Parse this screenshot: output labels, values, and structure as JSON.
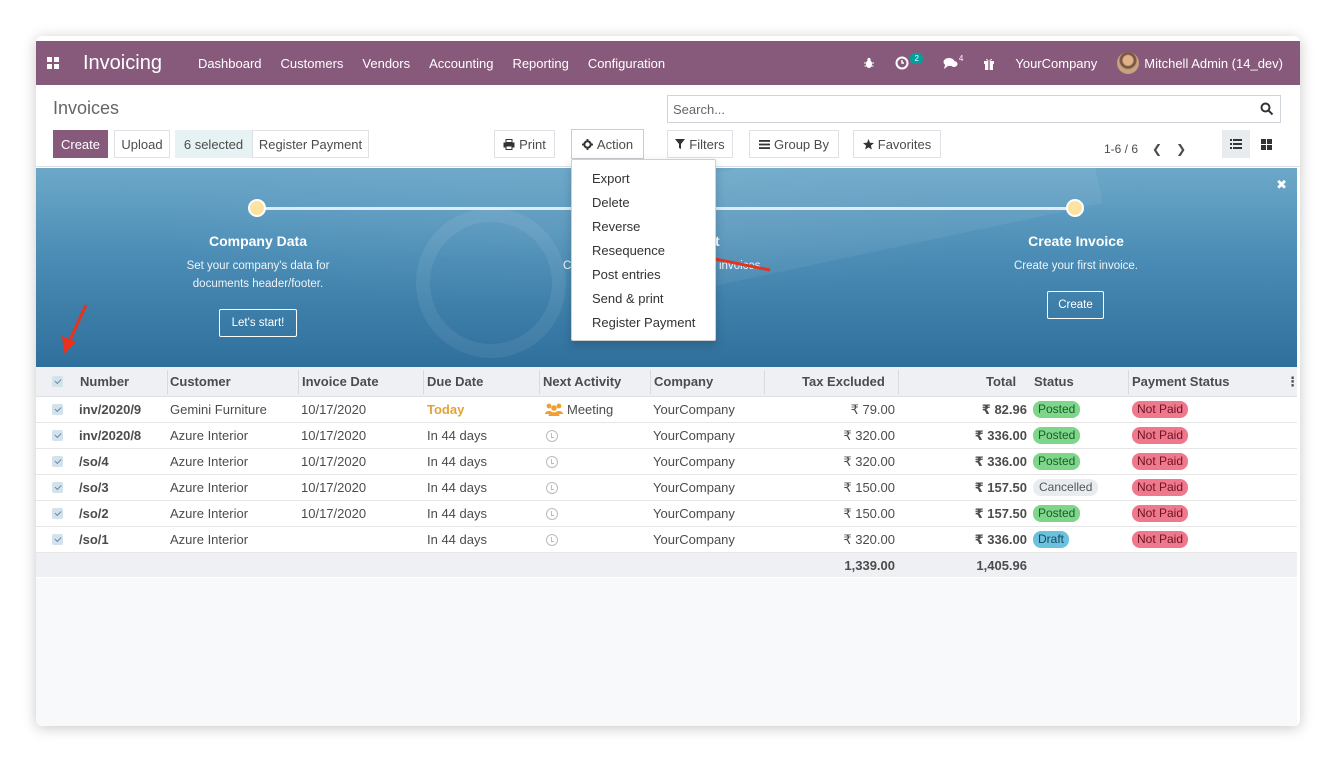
{
  "navbar": {
    "app_name": "Invoicing",
    "menu": [
      "Dashboard",
      "Customers",
      "Vendors",
      "Accounting",
      "Reporting",
      "Configuration"
    ],
    "activity_count": "2",
    "message_count": "4",
    "company": "YourCompany",
    "user": "Mitchell Admin (14_dev)",
    "brand_color": "#875a7b"
  },
  "control_panel": {
    "breadcrumb": "Invoices",
    "search_placeholder": "Search...",
    "create_label": "Create",
    "upload_label": "Upload",
    "selected_label": "6 selected",
    "register_payment_label": "Register Payment",
    "print_label": "Print",
    "action_label": "Action",
    "filters_label": "Filters",
    "group_by_label": "Group By",
    "favorites_label": "Favorites",
    "pager": "1-6 / 6"
  },
  "action_menu": [
    "Export",
    "Delete",
    "Reverse",
    "Resequence",
    "Post entries",
    "Send & print",
    "Register Payment"
  ],
  "onboarding": {
    "steps": [
      {
        "title": "Company Data",
        "desc1": "Set your company's data for",
        "desc2": "documents header/footer.",
        "button": "Let's start!"
      },
      {
        "title": "t",
        "desc1": "invoices."
      },
      {
        "title": "Create Invoice",
        "desc1": "Create your first invoice.",
        "button": "Create"
      }
    ],
    "partial_left": "C"
  },
  "table": {
    "columns": [
      "Number",
      "Customer",
      "Invoice Date",
      "Due Date",
      "Next Activity",
      "Company",
      "Tax Excluded",
      "Total",
      "Status",
      "Payment Status"
    ],
    "rows": [
      {
        "number": "inv/2020/9",
        "customer": "Gemini Furniture",
        "invoice_date": "10/17/2020",
        "due_date": "Today",
        "activity": "Meeting",
        "company": "YourCompany",
        "tax_excluded": "₹ 79.00",
        "total": "₹ 82.96",
        "status": "Posted",
        "payment_status": "Not Paid"
      },
      {
        "number": "inv/2020/8",
        "customer": "Azure Interior",
        "invoice_date": "10/17/2020",
        "due_date": "In 44 days",
        "activity": "",
        "company": "YourCompany",
        "tax_excluded": "₹ 320.00",
        "total": "₹ 336.00",
        "status": "Posted",
        "payment_status": "Not Paid"
      },
      {
        "number": "/so/4",
        "customer": "Azure Interior",
        "invoice_date": "10/17/2020",
        "due_date": "In 44 days",
        "activity": "",
        "company": "YourCompany",
        "tax_excluded": "₹ 320.00",
        "total": "₹ 336.00",
        "status": "Posted",
        "payment_status": "Not Paid"
      },
      {
        "number": "/so/3",
        "customer": "Azure Interior",
        "invoice_date": "10/17/2020",
        "due_date": "In 44 days",
        "activity": "",
        "company": "YourCompany",
        "tax_excluded": "₹ 150.00",
        "total": "₹ 157.50",
        "status": "Cancelled",
        "payment_status": "Not Paid"
      },
      {
        "number": "/so/2",
        "customer": "Azure Interior",
        "invoice_date": "10/17/2020",
        "due_date": "In 44 days",
        "activity": "",
        "company": "YourCompany",
        "tax_excluded": "₹ 150.00",
        "total": "₹ 157.50",
        "status": "Posted",
        "payment_status": "Not Paid"
      },
      {
        "number": "/so/1",
        "customer": "Azure Interior",
        "invoice_date": "",
        "due_date": "In 44 days",
        "activity": "",
        "company": "YourCompany",
        "tax_excluded": "₹ 320.00",
        "total": "₹ 336.00",
        "status": "Draft",
        "payment_status": "Not Paid"
      }
    ],
    "footer": {
      "tax_excluded": "1,339.00",
      "total": "1,405.96"
    }
  },
  "colors": {
    "posted": "#7dd68a",
    "cancelled": "#e9ecef",
    "draft": "#6cc1de",
    "not_paid": "#f0788c",
    "today": "#e0a33a",
    "annotation_arrow": "#e8321e"
  }
}
